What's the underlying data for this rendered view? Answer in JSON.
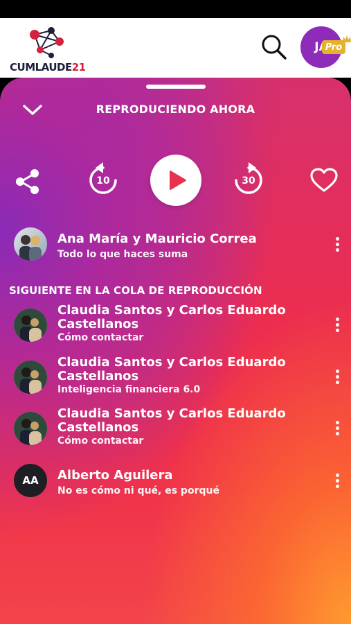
{
  "header": {
    "logo_text": "CUMLAUDE",
    "logo_number": "21",
    "avatar_initials": "JA",
    "pro_label": "Pro"
  },
  "player": {
    "title": "REPRODUCIENDO AHORA",
    "rewind_seconds": "10",
    "forward_seconds": "30",
    "now_playing": {
      "artist": "Ana María y Mauricio Correa",
      "track": "Todo lo que haces suma"
    }
  },
  "queue": {
    "heading": "SIGUIENTE EN LA COLA DE REPRODUCCIÓN",
    "items": [
      {
        "artist": "Claudia Santos y Carlos Eduardo Castellanos",
        "track": "Cómo contactar"
      },
      {
        "artist": "Claudia Santos y Carlos Eduardo Castellanos",
        "track": "Inteligencia financiera 6.0"
      },
      {
        "artist": "Claudia Santos y Carlos Eduardo Castellanos",
        "track": "Cómo contactar"
      },
      {
        "artist": "Alberto Aguilera",
        "track": "No es cómo ni qué, es porqué",
        "initials": "AA"
      }
    ]
  },
  "colors": {
    "accent_purple": "#8e2bb8",
    "pro_gold": "#e5b22d",
    "play_icon": "#e8314d"
  },
  "icons": [
    "collapse-chevron-icon",
    "share-icon",
    "rewind-icon",
    "play-icon",
    "forward-icon",
    "heart-icon",
    "search-icon",
    "more-icon",
    "crown-icon"
  ]
}
